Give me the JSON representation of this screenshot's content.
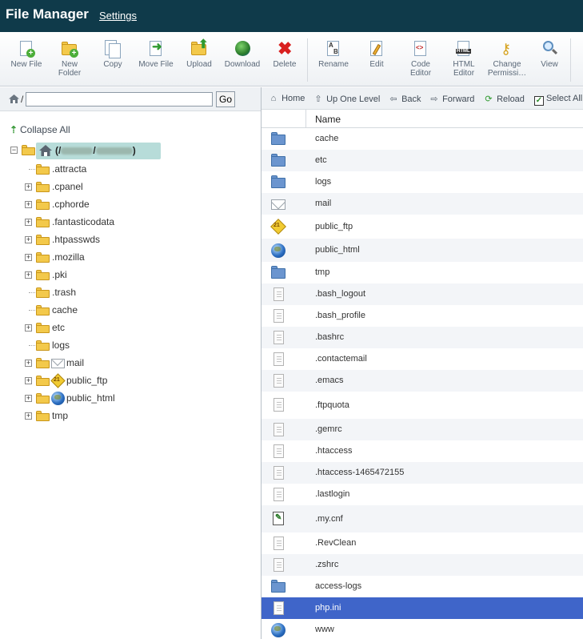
{
  "header": {
    "title": "File Manager",
    "settings_label": "Settings"
  },
  "toolbar": {
    "buttons": [
      {
        "label": "New File",
        "icon": "new-file-icon"
      },
      {
        "label": "New\nFolder",
        "icon": "new-folder-icon"
      },
      {
        "label": "Copy",
        "icon": "copy-icon"
      },
      {
        "label": "Move File",
        "icon": "move-file-icon"
      },
      {
        "label": "Upload",
        "icon": "upload-icon"
      },
      {
        "label": "Download",
        "icon": "download-icon"
      },
      {
        "label": "Delete",
        "icon": "delete-icon"
      },
      {
        "label": "Rename",
        "icon": "rename-icon"
      },
      {
        "label": "Edit",
        "icon": "edit-icon"
      },
      {
        "label": "Code\nEditor",
        "icon": "code-editor-icon"
      },
      {
        "label": "HTML\nEditor",
        "icon": "html-editor-icon"
      },
      {
        "label": "Change\nPermissi…",
        "icon": "key-icon"
      },
      {
        "label": "View",
        "icon": "magnifier-icon"
      }
    ]
  },
  "left": {
    "path_prefix": "/",
    "path_value": "",
    "go_label": "Go",
    "collapse_all_label": "Collapse All",
    "root_label_open": "(/",
    "root_label_sep": "/",
    "root_label_close": ")",
    "tree": [
      {
        "label": ".attracta",
        "expandable": false,
        "extra_icon": null
      },
      {
        "label": ".cpanel",
        "expandable": true,
        "extra_icon": null
      },
      {
        "label": ".cphorde",
        "expandable": true,
        "extra_icon": null
      },
      {
        "label": ".fantasticodata",
        "expandable": true,
        "extra_icon": null
      },
      {
        "label": ".htpasswds",
        "expandable": true,
        "extra_icon": null
      },
      {
        "label": ".mozilla",
        "expandable": true,
        "extra_icon": null
      },
      {
        "label": ".pki",
        "expandable": true,
        "extra_icon": null
      },
      {
        "label": ".trash",
        "expandable": false,
        "extra_icon": null
      },
      {
        "label": "cache",
        "expandable": false,
        "extra_icon": null
      },
      {
        "label": "etc",
        "expandable": true,
        "extra_icon": null
      },
      {
        "label": "logs",
        "expandable": false,
        "extra_icon": null
      },
      {
        "label": "mail",
        "expandable": true,
        "extra_icon": "mail-icon"
      },
      {
        "label": "public_ftp",
        "expandable": true,
        "extra_icon": "ftp-icon"
      },
      {
        "label": "public_html",
        "expandable": true,
        "extra_icon": "globe-icon"
      },
      {
        "label": "tmp",
        "expandable": true,
        "extra_icon": null
      }
    ]
  },
  "nav": {
    "home": "Home",
    "up": "Up One Level",
    "back": "Back",
    "forward": "Forward",
    "reload": "Reload",
    "select_all": "Select All"
  },
  "table": {
    "name_header": "Name",
    "rows": [
      {
        "name": "cache",
        "icon": "folder-icon"
      },
      {
        "name": "etc",
        "icon": "folder-icon"
      },
      {
        "name": "logs",
        "icon": "folder-icon"
      },
      {
        "name": "mail",
        "icon": "mail-icon"
      },
      {
        "name": "public_ftp",
        "icon": "ftp-icon"
      },
      {
        "name": "public_html",
        "icon": "globe-icon"
      },
      {
        "name": "tmp",
        "icon": "folder-icon"
      },
      {
        "name": ".bash_logout",
        "icon": "file-icon"
      },
      {
        "name": ".bash_profile",
        "icon": "file-icon"
      },
      {
        "name": ".bashrc",
        "icon": "file-icon"
      },
      {
        "name": ".contactemail",
        "icon": "file-icon"
      },
      {
        "name": ".emacs",
        "icon": "file-icon"
      },
      {
        "name": ".ftpquota",
        "icon": "file-icon"
      },
      {
        "name": ".gemrc",
        "icon": "file-icon"
      },
      {
        "name": ".htaccess",
        "icon": "file-icon"
      },
      {
        "name": ".htaccess-1465472155",
        "icon": "file-icon"
      },
      {
        "name": ".lastlogin",
        "icon": "file-icon"
      },
      {
        "name": ".my.cnf",
        "icon": "config-file-icon"
      },
      {
        "name": ".RevClean",
        "icon": "file-icon"
      },
      {
        "name": ".zshrc",
        "icon": "file-icon"
      },
      {
        "name": "access-logs",
        "icon": "folder-icon"
      },
      {
        "name": "php.ini",
        "icon": "file-icon",
        "selected": true
      },
      {
        "name": "www",
        "icon": "globe-icon"
      }
    ]
  },
  "colors": {
    "header_bg": "#0f3a4a",
    "selection": "#3f65c9",
    "root_highlight": "#b7dcd9",
    "folder_yellow": "#f3c94b",
    "folder_blue": "#6b95cf"
  }
}
